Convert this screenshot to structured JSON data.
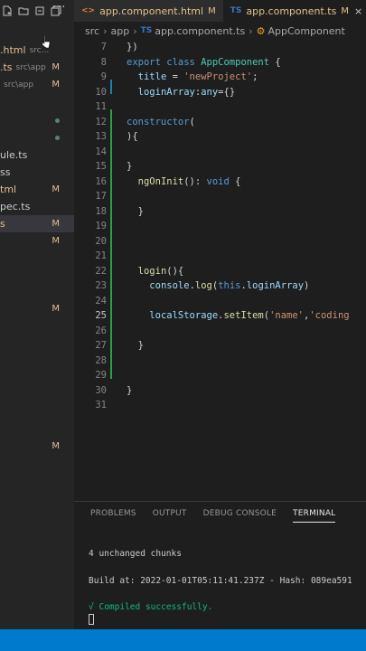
{
  "sidebar": {
    "open_editors": [
      {
        "name": ".html",
        "path": "src...",
        "badge": ""
      },
      {
        "name": ".ts",
        "path": "src\\app",
        "badge": "M"
      },
      {
        "name": "",
        "path": "src\\app",
        "badge": "M"
      }
    ],
    "files": [
      {
        "label": "",
        "badge": "",
        "status": "dot"
      },
      {
        "label": "",
        "badge": "",
        "status": "dot"
      },
      {
        "label": "ule.ts",
        "badge": "",
        "status": ""
      },
      {
        "label": "ss",
        "badge": "",
        "status": ""
      },
      {
        "label": "tml",
        "badge": "M",
        "status": "mod"
      },
      {
        "label": "pec.ts",
        "badge": "",
        "status": ""
      },
      {
        "label": "s",
        "badge": "M",
        "status": "mod"
      },
      {
        "label": "",
        "badge": "M",
        "status": "mod"
      }
    ],
    "lower_badges": [
      "M",
      "M"
    ]
  },
  "tabs": [
    {
      "icon": "<>",
      "name": "app.component.html",
      "badge": "M",
      "active": false
    },
    {
      "icon": "TS",
      "name": "app.component.ts",
      "badge": "M",
      "close": "×",
      "active": true
    }
  ],
  "breadcrumb": {
    "parts": [
      "src",
      "app",
      "app.component.ts",
      "AppComponent"
    ],
    "ts_badge": "TS"
  },
  "editor": {
    "lines": [
      {
        "n": "7",
        "text": "})"
      },
      {
        "n": "8",
        "text": "export class AppComponent {"
      },
      {
        "n": "9",
        "text": "  title = 'newProject';"
      },
      {
        "n": "10",
        "text": "  loginArray:any={}"
      },
      {
        "n": "11",
        "text": ""
      },
      {
        "n": "12",
        "text": "constructor("
      },
      {
        "n": "13",
        "text": "){"
      },
      {
        "n": "14",
        "text": ""
      },
      {
        "n": "15",
        "text": "}"
      },
      {
        "n": "16",
        "text": "  ngOnInit(): void {"
      },
      {
        "n": "17",
        "text": ""
      },
      {
        "n": "18",
        "text": "  }"
      },
      {
        "n": "19",
        "text": ""
      },
      {
        "n": "20",
        "text": ""
      },
      {
        "n": "21",
        "text": ""
      },
      {
        "n": "22",
        "text": "  login(){"
      },
      {
        "n": "23",
        "text": "    console.log(this.loginArray)"
      },
      {
        "n": "24",
        "text": ""
      },
      {
        "n": "25",
        "text": "    localStorage.setItem('name','coding"
      },
      {
        "n": "26",
        "text": ""
      },
      {
        "n": "27",
        "text": "  }"
      },
      {
        "n": "28",
        "text": ""
      },
      {
        "n": "29",
        "text": ""
      },
      {
        "n": "30",
        "text": "}"
      },
      {
        "n": "31",
        "text": ""
      }
    ]
  },
  "panel": {
    "tabs": [
      "PROBLEMS",
      "OUTPUT",
      "DEBUG CONSOLE",
      "TERMINAL"
    ],
    "active_tab": "TERMINAL",
    "terminal": {
      "line1": "4 unchanged chunks",
      "line2": "Build at: 2022-01-01T05:11:41.237Z - Hash: 089ea591",
      "check": "√",
      "line3": "Compiled successfully."
    }
  },
  "colors": {
    "status_bar": "#007acc",
    "modified": "#e2c08d",
    "keyword": "#569cd6",
    "class_name": "#4ec9b0",
    "string": "#ce9178"
  }
}
